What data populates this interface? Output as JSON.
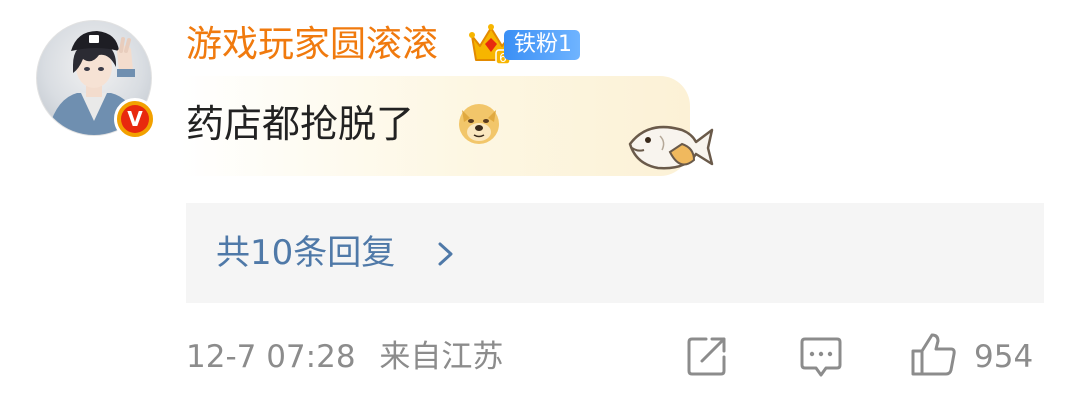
{
  "colors": {
    "username": "#f07a0e",
    "reply_link": "#4f79a8",
    "meta_text": "#8c8c8c",
    "reply_bg": "#f5f5f5",
    "fan_badge": "#3a8ff5",
    "verified_badge": "#e8290e"
  },
  "user": {
    "name": "游戏玩家圆滚滚",
    "avatar_icon": "avatar-portrait",
    "verified_icon": "verified-v-icon",
    "verified_label": "V",
    "fan_badge_label": "铁粉1",
    "crown_icon": "crown-icon",
    "crown_level": "6"
  },
  "comment": {
    "text": "药店都抢脱了",
    "emoji": "doge-emoji",
    "decoration": "fish-sticker"
  },
  "replies": {
    "label": "共10条回复",
    "arrow_icon": "chevron-right-icon"
  },
  "meta": {
    "timestamp": "12-7 07:28",
    "location": "来自江苏"
  },
  "actions": {
    "share_icon": "share-icon",
    "comment_icon": "comment-icon",
    "like_icon": "thumbs-up-icon",
    "like_count": "954"
  }
}
